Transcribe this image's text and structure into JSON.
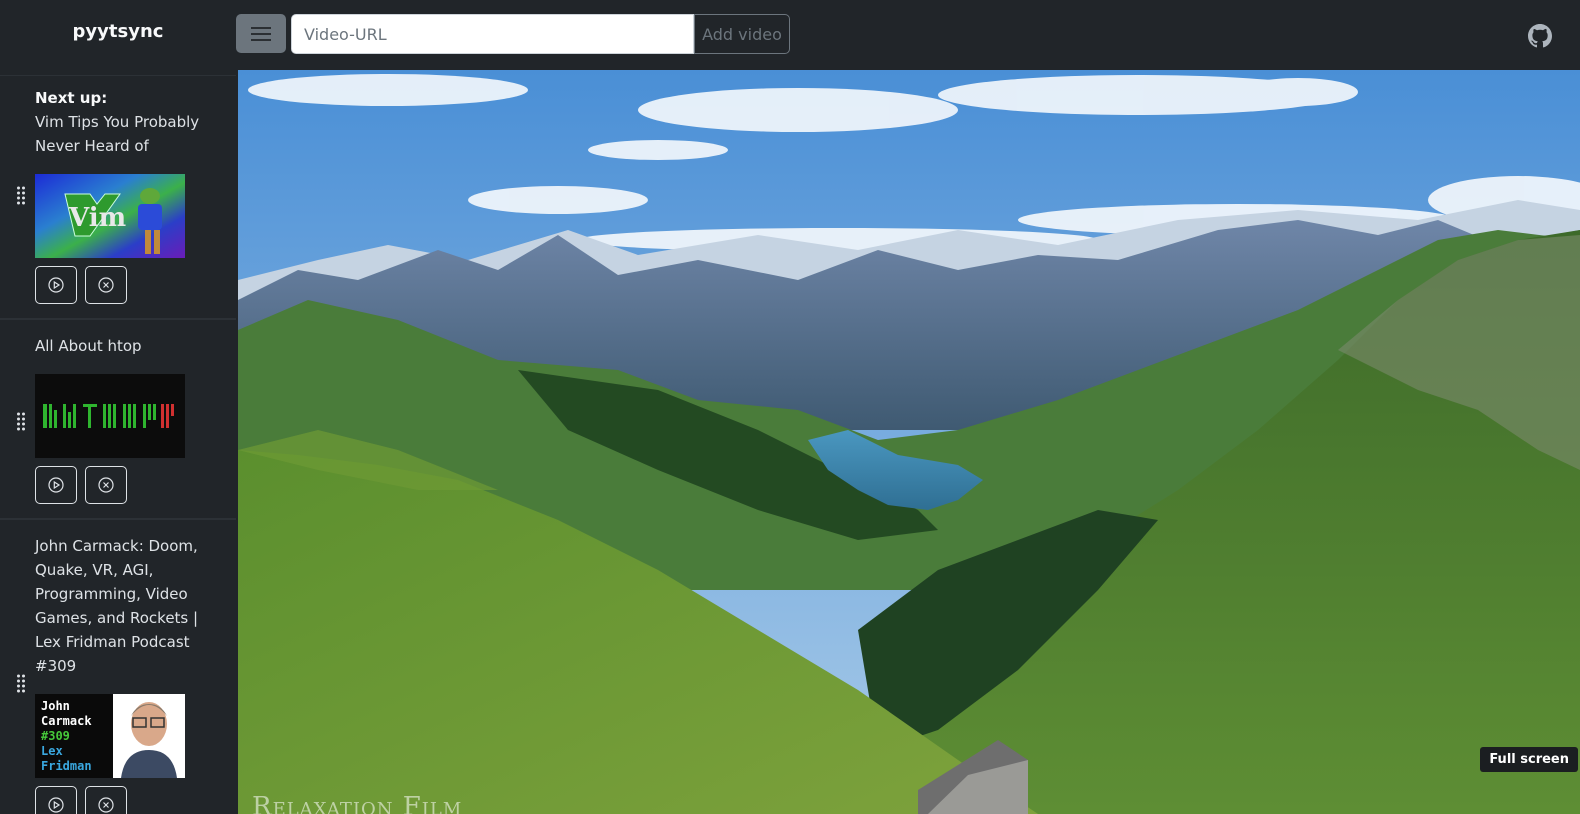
{
  "brand": "pyytsync",
  "header": {
    "url_placeholder": "Video-URL",
    "add_label": "Add video"
  },
  "queue": {
    "next_label": "Next up:",
    "items": [
      {
        "title": "Vim Tips You Probably Never Heard of",
        "thumb_text": "Vim"
      },
      {
        "title": "All About htop",
        "thumb_text": "htop"
      },
      {
        "title": "John Carmack: Doom, Quake, VR, AGI, Programming, Video Games, and Rockets | Lex Fridman Podcast #309",
        "thumb_lines": [
          "John",
          "Carmack",
          "#309",
          "Lex",
          "Fridman"
        ]
      }
    ]
  },
  "player": {
    "fullscreen_label": "Full screen",
    "watermark": "Relaxation Film"
  },
  "colors": {
    "bg": "#212529",
    "button_secondary": "#6c757d"
  },
  "icons": [
    "hamburger-icon",
    "github-icon",
    "drag-handle-icon",
    "play-circle-icon",
    "x-circle-icon"
  ]
}
